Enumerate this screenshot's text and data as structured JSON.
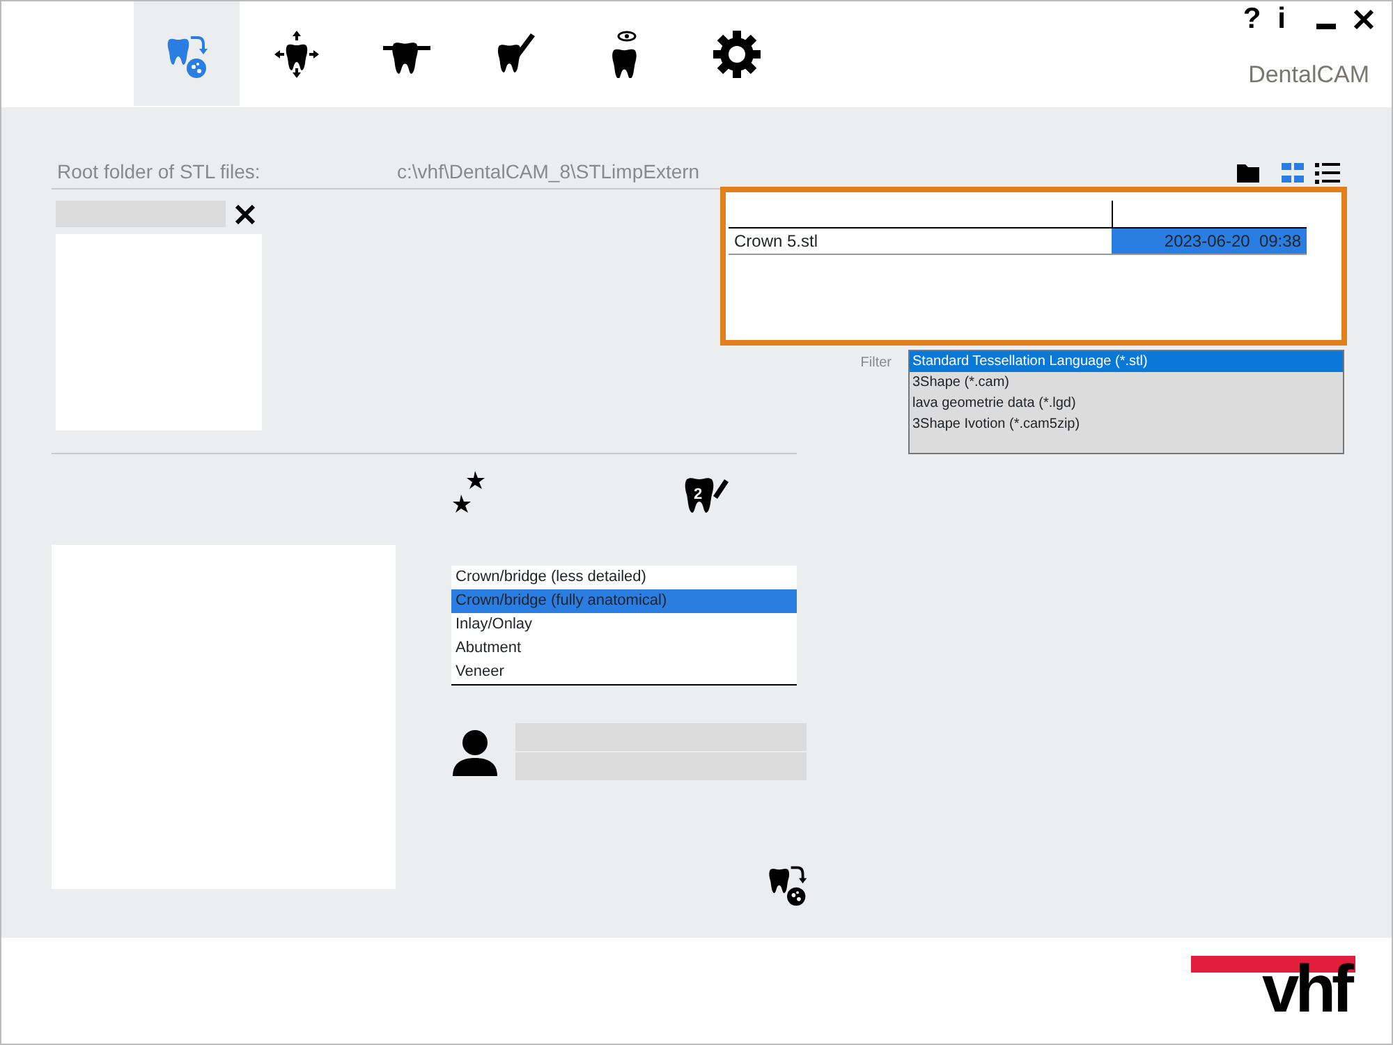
{
  "window": {
    "help": "?",
    "info": "i",
    "app_name": "DentalCAM"
  },
  "tabs": [
    {
      "kind": "import",
      "selected": true
    },
    {
      "kind": "position",
      "selected": false
    },
    {
      "kind": "margin",
      "selected": false
    },
    {
      "kind": "design",
      "selected": false
    },
    {
      "kind": "view",
      "selected": false
    },
    {
      "kind": "settings",
      "selected": false
    }
  ],
  "root_folder": {
    "label": "Root folder of STL files:",
    "path": "c:\\vhf\\DentalCAM_8\\STLimpExtern"
  },
  "view_buttons": [
    {
      "kind": "folder",
      "selected": false
    },
    {
      "kind": "thumbnails",
      "selected": true
    },
    {
      "kind": "list",
      "selected": false
    }
  ],
  "file_table": {
    "rows": [
      {
        "name": "Crown 5.stl",
        "date": "2023-06-20  09:38",
        "selected": true
      }
    ]
  },
  "filter": {
    "label": "Filter",
    "options": [
      {
        "label": "Standard Tessellation Language (*.stl)",
        "selected": true
      },
      {
        "label": "3Shape (*.cam)",
        "selected": false
      },
      {
        "label": "lava geometrie data (*.lgd)",
        "selected": false
      },
      {
        "label": "3Shape Ivotion (*.cam5zip)",
        "selected": false
      }
    ]
  },
  "restoration_types": [
    {
      "label": "Crown/bridge (less detailed)",
      "selected": false
    },
    {
      "label": "Crown/bridge (fully anatomical)",
      "selected": true
    },
    {
      "label": "Inlay/Onlay",
      "selected": false
    },
    {
      "label": "Abutment",
      "selected": false
    },
    {
      "label": "Veneer",
      "selected": false
    }
  ],
  "design_tool": {
    "number": "2"
  },
  "logo": {
    "text": "vhf"
  }
}
